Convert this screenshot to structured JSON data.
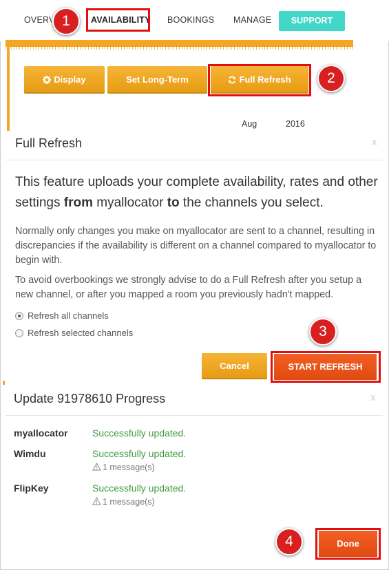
{
  "nav": {
    "overview": "OVERVIEW",
    "availability": "AVAILABILITY",
    "bookings": "BOOKINGS",
    "manage": "MANAGE",
    "support": "SUPPORT"
  },
  "toolbar": {
    "display": "Display",
    "long_term": "Set Long-Term",
    "full_refresh": "Full Refresh"
  },
  "calendar": {
    "month": "Aug",
    "year": "2016"
  },
  "callouts": [
    "1",
    "2",
    "3",
    "4"
  ],
  "full_refresh_modal": {
    "title": "Full Refresh",
    "close": "x",
    "lead_1": "This feature uploads your complete availability, rates and other settings ",
    "lead_from": "from",
    "lead_2": " myallocator ",
    "lead_to": "to",
    "lead_3": " the channels you select.",
    "para_1": "Normally only changes you make on myallocator are sent to a channel, resulting in discrepancies if the availability is different on a channel compared to myallocator to begin with.",
    "para_2": "To avoid overbookings we strongly advise to do a Full Refresh after you setup a new channel, or after you mapped a room you previously hadn't mapped.",
    "radio_all": "Refresh all channels",
    "radio_selected": "Refresh selected channels",
    "cancel": "Cancel",
    "start": "START REFRESH"
  },
  "progress_modal": {
    "title": "Update 91978610 Progress",
    "close": "x",
    "rows": [
      {
        "channel": "myallocator",
        "status": "Successfully updated.",
        "message": ""
      },
      {
        "channel": "Wimdu",
        "status": "Successfully updated.",
        "message": "1 message(s)"
      },
      {
        "channel": "FlipKey",
        "status": "Successfully updated.",
        "message": "1 message(s)"
      }
    ],
    "done": "Done"
  },
  "colors": {
    "accent_orange": "#f5a623",
    "support_teal": "#42d7c8",
    "highlight_red": "#e01010",
    "success_green": "#3e9a3e",
    "start_red": "#f25f24"
  },
  "icons": [
    "gear-icon",
    "refresh-icon",
    "warning-icon"
  ]
}
